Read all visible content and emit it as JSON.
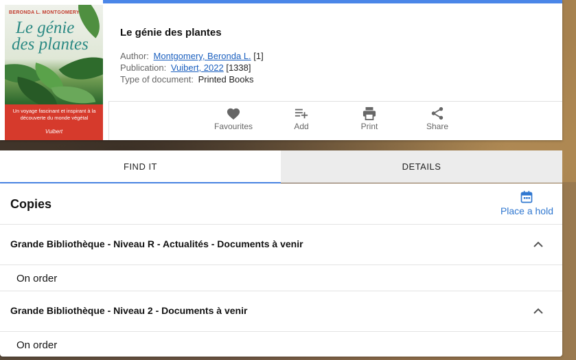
{
  "book": {
    "cover": {
      "author_text": "BERONDA L. MONTGOMERY",
      "title_line1": "Le génie",
      "title_line2": "des plantes",
      "tagline": "Un voyage fascinant et inspirant à la découverte du monde végétal",
      "publisher_text": "Vuibert"
    },
    "title": "Le génie des plantes",
    "author_label": "Author:",
    "author_value": "Montgomery, Beronda L.",
    "author_count": "[1]",
    "publication_label": "Publication:",
    "publication_value": "Vuibert, 2022",
    "publication_count": "[1338]",
    "type_label": "Type of document:",
    "type_value": "Printed Books"
  },
  "actions": {
    "favourites": "Favourites",
    "add": "Add",
    "print": "Print",
    "share": "Share"
  },
  "tabs": {
    "find_it": "FIND IT",
    "details": "DETAILS"
  },
  "copies": {
    "title": "Copies",
    "place_hold": "Place a hold",
    "groups": [
      {
        "location": "Grande Bibliothèque - Niveau R - Actualités - Documents à venir",
        "status": "On order"
      },
      {
        "location": "Grande Bibliothèque - Niveau 2 - Documents à venir",
        "status": "On order"
      }
    ]
  },
  "colors": {
    "accent": "#4a86e8",
    "link": "#1a5fbf",
    "hold": "#2f77d0"
  }
}
